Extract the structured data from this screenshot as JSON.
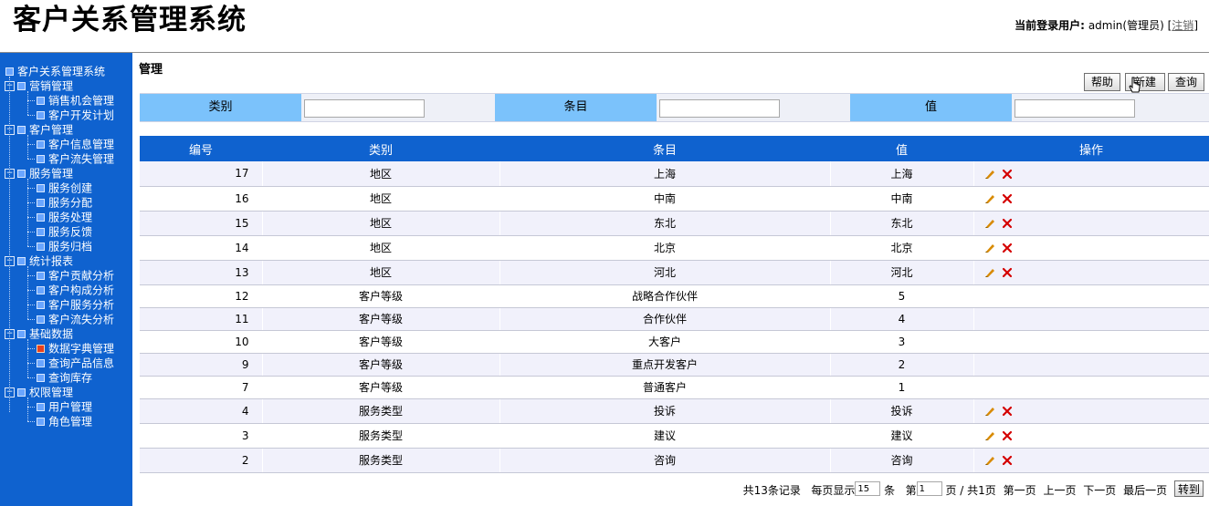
{
  "header": {
    "title": "客户关系管理系统",
    "login_label": "当前登录用户:",
    "login_user": "admin(管理员)",
    "logout_open": "[",
    "logout_label": "注销",
    "logout_close": "]"
  },
  "sidebar": {
    "root": "客户关系管理系统",
    "groups": [
      {
        "label": "营销管理",
        "items": [
          "销售机会管理",
          "客户开发计划"
        ]
      },
      {
        "label": "客户管理",
        "items": [
          "客户信息管理",
          "客户流失管理"
        ]
      },
      {
        "label": "服务管理",
        "items": [
          "服务创建",
          "服务分配",
          "服务处理",
          "服务反馈",
          "服务归档"
        ]
      },
      {
        "label": "统计报表",
        "items": [
          "客户贡献分析",
          "客户构成分析",
          "客户服务分析",
          "客户流失分析"
        ]
      },
      {
        "label": "基础数据",
        "items": [
          "数据字典管理",
          "查询产品信息",
          "查询库存"
        ]
      },
      {
        "label": "权限管理",
        "items": [
          "用户管理",
          "角色管理"
        ]
      }
    ],
    "active_item": "数据字典管理"
  },
  "main": {
    "section_title": "管理",
    "toolbar": {
      "help_label": "帮助",
      "new_label": "新建",
      "query_label": "查询"
    },
    "search": {
      "category_label": "类别",
      "category_value": "",
      "item_label": "条目",
      "item_value": "",
      "value_label": "值",
      "value_value": ""
    },
    "table": {
      "columns": [
        "编号",
        "类别",
        "条目",
        "值",
        "操作"
      ],
      "rows": [
        {
          "id": "17",
          "category": "地区",
          "item": "上海",
          "value": "上海",
          "editable": true
        },
        {
          "id": "16",
          "category": "地区",
          "item": "中南",
          "value": "中南",
          "editable": true
        },
        {
          "id": "15",
          "category": "地区",
          "item": "东北",
          "value": "东北",
          "editable": true
        },
        {
          "id": "14",
          "category": "地区",
          "item": "北京",
          "value": "北京",
          "editable": true
        },
        {
          "id": "13",
          "category": "地区",
          "item": "河北",
          "value": "河北",
          "editable": true
        },
        {
          "id": "12",
          "category": "客户等级",
          "item": "战略合作伙伴",
          "value": "5",
          "editable": false
        },
        {
          "id": "11",
          "category": "客户等级",
          "item": "合作伙伴",
          "value": "4",
          "editable": false
        },
        {
          "id": "10",
          "category": "客户等级",
          "item": "大客户",
          "value": "3",
          "editable": false
        },
        {
          "id": "9",
          "category": "客户等级",
          "item": "重点开发客户",
          "value": "2",
          "editable": false
        },
        {
          "id": "7",
          "category": "客户等级",
          "item": "普通客户",
          "value": "1",
          "editable": false
        },
        {
          "id": "4",
          "category": "服务类型",
          "item": "投诉",
          "value": "投诉",
          "editable": true
        },
        {
          "id": "3",
          "category": "服务类型",
          "item": "建议",
          "value": "建议",
          "editable": true
        },
        {
          "id": "2",
          "category": "服务类型",
          "item": "咨询",
          "value": "咨询",
          "editable": true
        }
      ]
    },
    "pager": {
      "total_text": "共13条记录",
      "per_page_label": "每页显示",
      "per_page_value": "15",
      "per_page_unit": "条",
      "page_prefix": "第",
      "page_value": "1",
      "page_suffix": "页 / 共1页",
      "first_label": "第一页",
      "prev_label": "上一页",
      "next_label": "下一页",
      "last_label": "最后一页",
      "go_label": "转到"
    }
  },
  "colors": {
    "sidebar_bg": "#0f62cf",
    "table_header_bg": "#0f62cf",
    "search_label_bg": "#7bc2fb",
    "row_odd_bg": "#f1f1fb",
    "row_even_bg": "#ffffff",
    "edit_icon": "#d88a00",
    "delete_icon": "#d40000"
  }
}
